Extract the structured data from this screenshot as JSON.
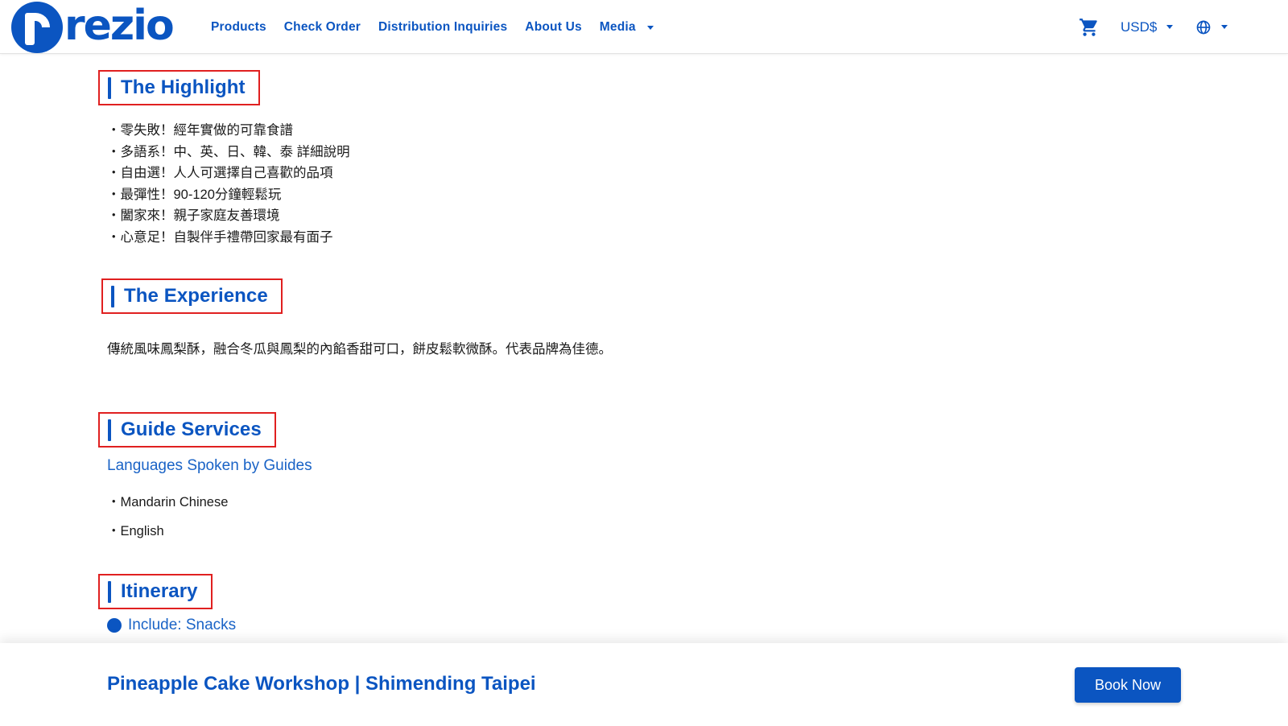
{
  "brand": {
    "name": "rezio",
    "color": "#0b55c1"
  },
  "nav": {
    "items": [
      "Products",
      "Check Order",
      "Distribution Inquiries",
      "About Us",
      "Media"
    ],
    "more_icon": "caret-down-icon"
  },
  "tools": {
    "cart_icon": "cart-icon",
    "currency": "USD$",
    "language_icon": "globe-icon"
  },
  "sections": {
    "highlight": {
      "title": "The Highlight",
      "items": [
        "・零失敗！經年實做的可靠食譜",
        "・多語系！中、英、日、韓、泰 詳細說明",
        "・自由選！人人可選擇自己喜歡的品項",
        "・最彈性！90-120分鐘輕鬆玩",
        "・闔家來！親子家庭友善環境",
        "・心意足！自製伴手禮帶回家最有面子"
      ]
    },
    "experience": {
      "title": "The Experience",
      "description": "傳統風味鳳梨酥，融合冬瓜與鳳梨的內餡香甜可口，餅皮鬆軟微酥。代表品牌為佳德。"
    },
    "guide": {
      "title": "Guide Services",
      "languages_label": "Languages Spoken by Guides",
      "languages": [
        "・Mandarin Chinese",
        "・English"
      ]
    },
    "itinerary": {
      "title": "Itinerary",
      "include": "Include: Snacks"
    }
  },
  "footer": {
    "product_title": "Pineapple Cake Workshop | Shimending Taipei",
    "book_label": "Book Now"
  },
  "colors": {
    "accent": "#0b55c1",
    "highlight_border": "#e02020"
  }
}
